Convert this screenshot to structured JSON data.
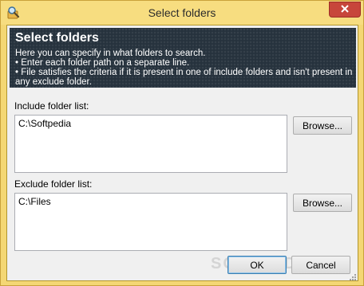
{
  "window": {
    "title": "Select folders",
    "icon": "magnifier-folder-icon",
    "close_icon": "close-icon"
  },
  "banner": {
    "title": "Select folders",
    "lines": [
      "Here you can specify in what folders to search.",
      "• Enter each folder path on a separate line.",
      "• File satisfies the criteria if it is present in one of include folders and isn't present in",
      "any exclude folder."
    ]
  },
  "include": {
    "label": "Include folder list:",
    "value": "C:\\Softpedia",
    "browse_label": "Browse..."
  },
  "exclude": {
    "label": "Exclude folder list:",
    "value": "C:\\Files",
    "browse_label": "Browse..."
  },
  "footer": {
    "ok_label": "OK",
    "cancel_label": "Cancel"
  },
  "watermark": "SOFTPEDIA",
  "colors": {
    "titlebar": "#f7dd80",
    "banner_bg": "#26323d",
    "close_button": "#c7463b"
  }
}
